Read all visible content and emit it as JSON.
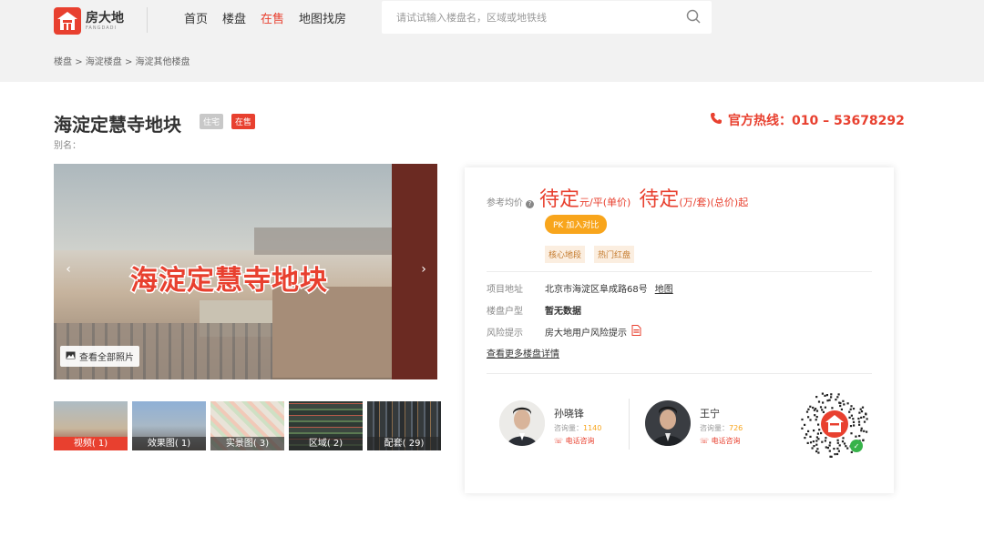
{
  "brand": {
    "name_cn": "房大地",
    "name_en": "FANGDADI"
  },
  "nav": [
    "首页",
    "楼盘",
    "在售",
    "地图找房"
  ],
  "nav_active": "在售",
  "search": {
    "placeholder": "请试试输入楼盘名，区域或地铁线"
  },
  "breadcrumb": [
    "楼盘",
    "海淀楼盘",
    "海淀其他楼盘"
  ],
  "breadcrumb_sep": ">",
  "property": {
    "title": "海淀定慧寺地块",
    "tag_type": "住宅",
    "tag_status": "在售",
    "alias_label": "别名：",
    "photo_overlay_title": "海淀定慧寺地块",
    "view_all_photos": "查看全部照片"
  },
  "hotline": {
    "label": "官方热线：",
    "number": "010 – 53678292"
  },
  "thumbnails": [
    {
      "label": "视频( 1)",
      "active": true
    },
    {
      "label": "效果图( 1)",
      "active": false
    },
    {
      "label": "实景图( 3)",
      "active": false
    },
    {
      "label": "区域( 2)",
      "active": false
    },
    {
      "label": "配套( 29)",
      "active": false
    }
  ],
  "price": {
    "label": "参考均价",
    "unit_price": "待定",
    "unit_price_unit": "元/平(单价)",
    "total_price": "待定",
    "total_price_unit": "(万/套)(总价)起"
  },
  "compare_button": "PK 加入对比",
  "features": [
    "核心地段",
    "热门红盘"
  ],
  "info": [
    {
      "key": "项目地址",
      "value": "北京市海淀区阜成路68号",
      "link": "地图"
    },
    {
      "key": "楼盘户型",
      "value": "暂无数据"
    },
    {
      "key": "风险提示",
      "value": "房大地用户风险提示"
    }
  ],
  "more_details": "查看更多楼盘详情",
  "agents": [
    {
      "name": "孙晓锋",
      "count_label": "咨询量：",
      "count": "1140",
      "call": "电话咨询"
    },
    {
      "name": "王宁",
      "count_label": "咨询量：",
      "count": "726",
      "call": "电话咨询"
    }
  ],
  "colors": {
    "accent": "#e8402f",
    "orange": "#f8a51c"
  }
}
